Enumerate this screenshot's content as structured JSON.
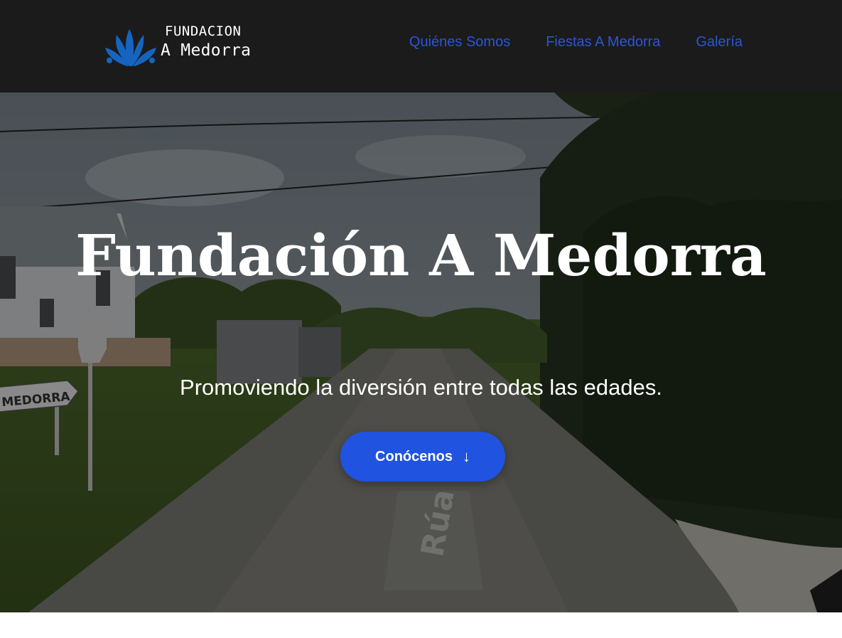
{
  "header": {
    "logo": {
      "line1": "FUNDACION",
      "line2": "A Medorra",
      "mark_icon": "blue-splash-icon",
      "color": "#1565c0"
    },
    "nav": [
      {
        "label": "Quiénes Somos"
      },
      {
        "label": "Fiestas A Medorra"
      },
      {
        "label": "Galería"
      }
    ],
    "nav_color": "#2b56d6"
  },
  "hero": {
    "title": "Fundación A Medorra",
    "subtitle": "Promoviendo la diversión entre todas las edades.",
    "cta": {
      "label": "Conócenos",
      "icon": "arrow-down-icon",
      "color": "#2053e0"
    },
    "background": {
      "sign_text": "MEDORRA",
      "road_text": "Rúa"
    }
  }
}
